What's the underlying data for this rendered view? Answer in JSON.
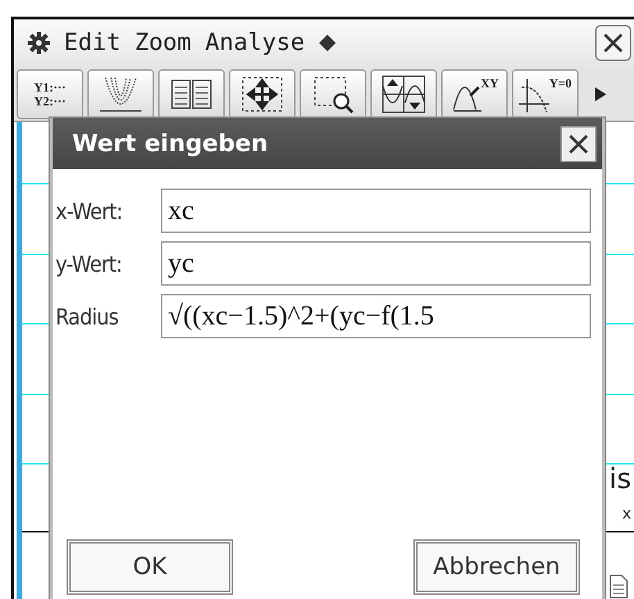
{
  "menu": {
    "items": [
      "Edit",
      "Zoom",
      "Analyse"
    ]
  },
  "toolbar": {
    "buttons": [
      {
        "kind": "y1y2",
        "label": "Y1:···",
        "label2": "Y2:···"
      },
      {
        "kind": "parabolas"
      },
      {
        "kind": "table"
      },
      {
        "kind": "pan"
      },
      {
        "kind": "zoombox"
      },
      {
        "kind": "trace"
      },
      {
        "kind": "xy",
        "label": "XY"
      },
      {
        "kind": "root",
        "label": "Y=0"
      }
    ]
  },
  "background": {
    "text_1": "is",
    "text_2": "x"
  },
  "dialog": {
    "title": "Wert eingeben",
    "fields": [
      {
        "label": "x-Wert:",
        "value": "xc"
      },
      {
        "label": "y-Wert:",
        "value": "yc"
      },
      {
        "label": "Radius",
        "value": "√((xc−1.5)^2+(yc−f(1.5"
      }
    ],
    "buttons": [
      "OK",
      "Abbrechen"
    ]
  }
}
